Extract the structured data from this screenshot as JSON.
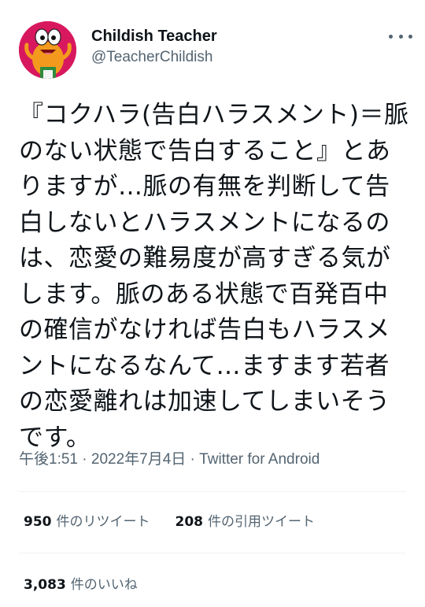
{
  "author": {
    "display_name": "Childish Teacher",
    "handle": "@TeacherChildish",
    "avatar_icon": "cartoon-fish-avatar-icon"
  },
  "tweet": {
    "text": "『コクハラ(告白ハラスメント)＝脈のない状態で告白すること』とありますが…脈の有無を判断して告白しないとハラスメントになるのは、恋愛の難易度が高すぎる気がします。脈のある状態で百発百中の確信がなければ告白もハラスメントになるなんて…ますます若者の恋愛離れは加速してしまいそうです。"
  },
  "meta": {
    "time": "午後1:51",
    "separator": " · ",
    "date": "2022年7月4日",
    "source": "Twitter for Android"
  },
  "stats": {
    "retweets": {
      "count": "950",
      "label": "件のリツイート"
    },
    "quotes": {
      "count": "208",
      "label": "件の引用ツイート"
    },
    "likes": {
      "count": "3,083",
      "label": "件のいいね"
    }
  },
  "colors": {
    "text": "#0f1419",
    "secondary": "#536471",
    "divider": "#eff3f4",
    "avatar_bg": "#d8185e",
    "avatar_fish": "#f39a1e"
  }
}
